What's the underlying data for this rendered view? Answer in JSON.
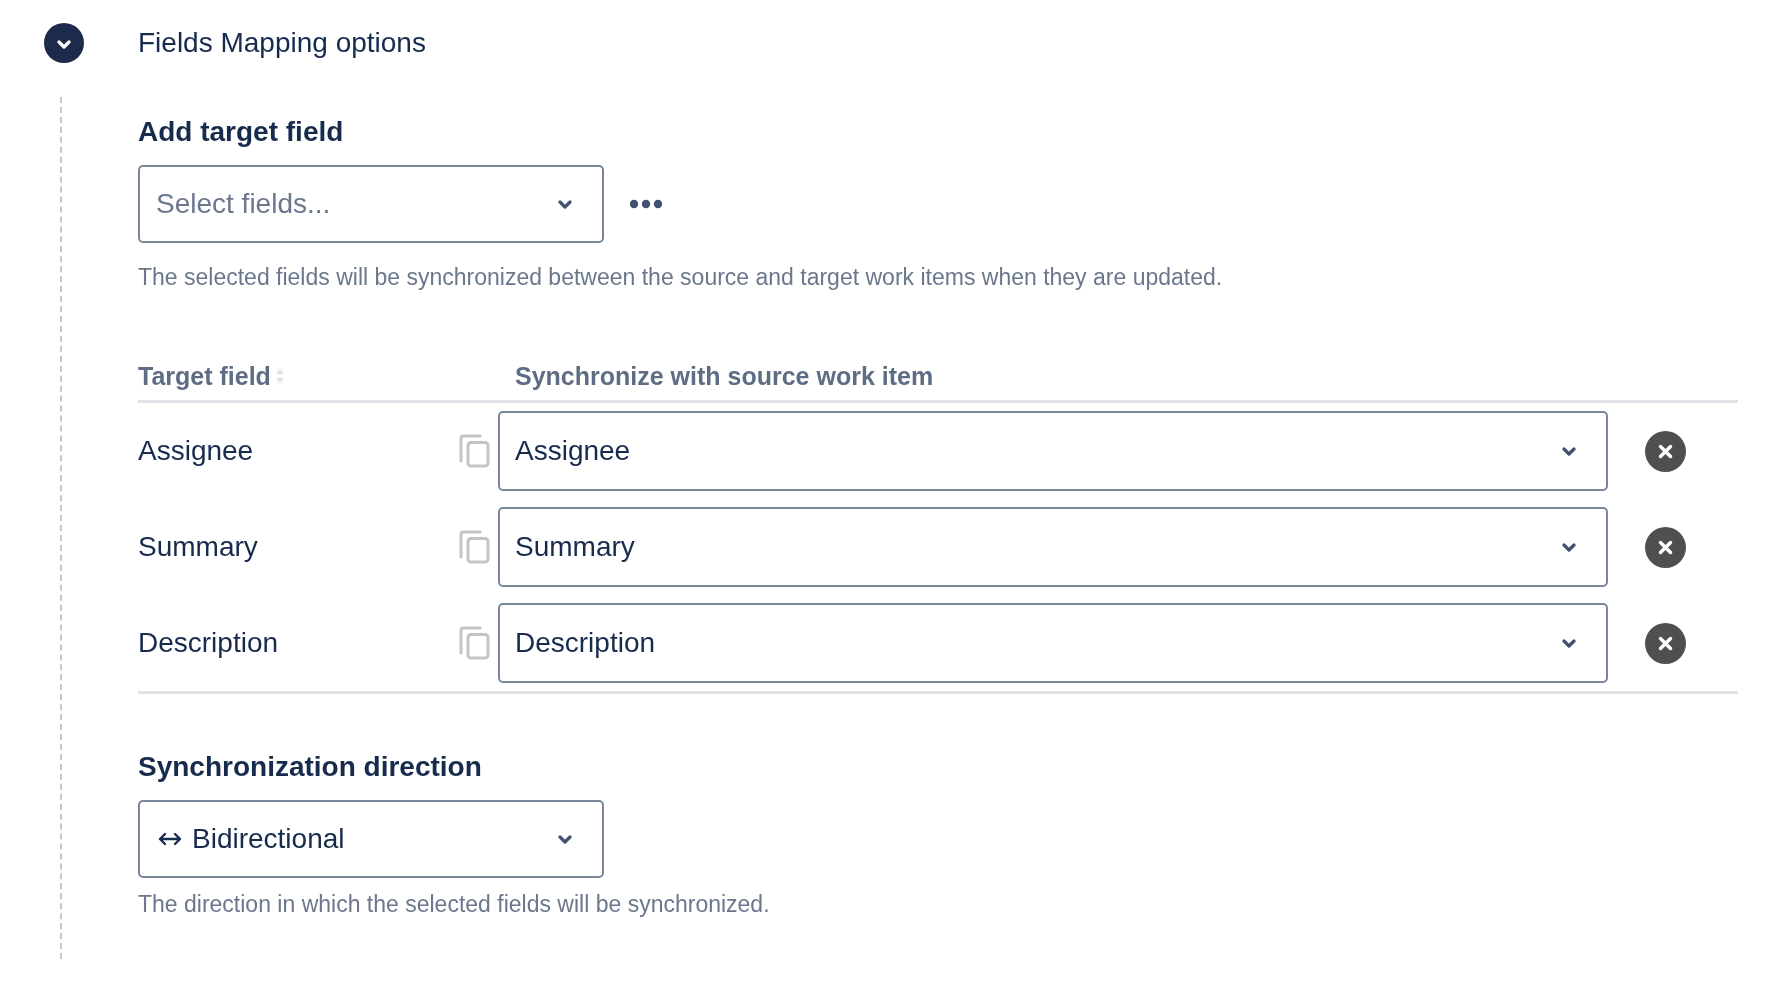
{
  "section": {
    "title": "Fields Mapping options",
    "expanded": true
  },
  "add_target_field": {
    "label": "Add target field",
    "select": {
      "placeholder": "Select fields..."
    },
    "help": "The selected fields will be synchronized between the source and target work items when they are updated."
  },
  "mapping_table": {
    "columns": [
      {
        "label": "Target field",
        "sortable": true
      },
      {
        "label": "Synchronize with source work item",
        "sortable": false
      }
    ],
    "rows": [
      {
        "target_field": "Assignee",
        "source_field": "Assignee"
      },
      {
        "target_field": "Summary",
        "source_field": "Summary"
      },
      {
        "target_field": "Description",
        "source_field": "Description"
      }
    ]
  },
  "synchronization_direction": {
    "label": "Synchronization direction",
    "select": {
      "value": "Bidirectional"
    },
    "help": "The direction in which the selected fields will be synchronized."
  }
}
